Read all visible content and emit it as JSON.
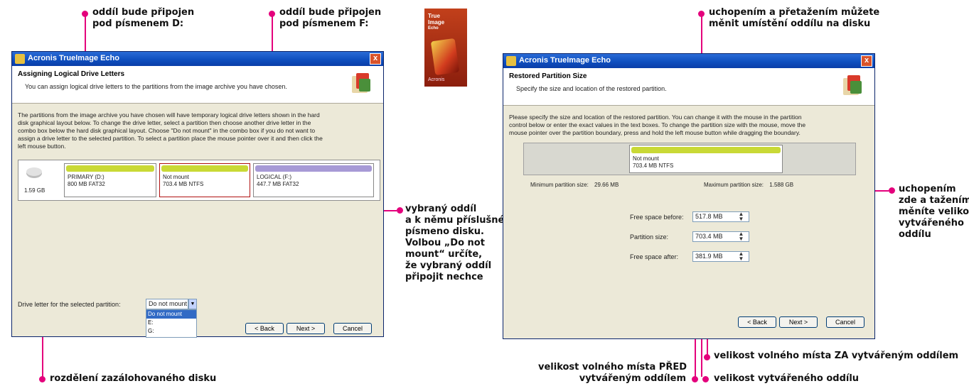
{
  "annotations": {
    "drive_d_l1": "oddíl bude připojen",
    "drive_d_l2": "pod písmenem D:",
    "drive_f_l1": "oddíl bude připojen",
    "drive_f_l2": "pod písmenem F:",
    "selected_l1": "vybraný oddíl",
    "selected_l2": "a k němu příslušné",
    "selected_l3": "písmeno disku.",
    "selected_l4": "Volbou „Do not",
    "selected_l5": "mount“ určíte,",
    "selected_l6": "že vybraný oddíl",
    "selected_l7": "připojit nechce",
    "layout": "rozdělení zazálohovaného disku",
    "drag_l1": "uchopením a přetažením můžete",
    "drag_l2": "měnit umístění oddílu na disku",
    "resize_l1": "uchopením",
    "resize_l2": "zde a tažením",
    "resize_l3": "měníte velikost",
    "resize_l4": "vytvářeného",
    "resize_l5": "oddílu",
    "after": "velikost volného místa ZA vytvářeným oddílem",
    "before_l1": "velikost volného místa PŘED",
    "before_l2": "vytvářeným oddílem",
    "partsize": "velikost vytvářeného oddílu"
  },
  "book": {
    "title_l1": "True",
    "title_l2": "Image",
    "title_l3": "Echo",
    "footer": "Acronis"
  },
  "window_left": {
    "title": "Acronis TrueImage Echo",
    "close": "x",
    "header_title": "Assigning Logical Drive Letters",
    "header_sub": "You can assign logical drive letters to the partitions from the image archive you have chosen.",
    "para1": "The partitions from the image archive you have chosen will have temporary logical drive letters shown in the hard",
    "para2": "disk graphical layout below. To change the drive letter, select a partition then choose another drive letter in the",
    "para3": "combo box below the hard disk graphical layout. Choose \"Do not mount\" in the combo box if you do not want to",
    "para4": "assign a drive letter to the selected partition. To select a partition place the mouse pointer over it and then click the",
    "para5": "left mouse button.",
    "disk_label": "1.59 GB",
    "partitions": [
      {
        "l1": "PRIMARY (D:)",
        "l2": "800 MB FAT32"
      },
      {
        "l1": "Not mount",
        "l2": "703.4 MB NTFS"
      },
      {
        "l1": "LOGICAL (F:)",
        "l2": "447.7 MB FAT32"
      }
    ],
    "drive_letter_label": "Drive letter for the selected partition:",
    "combo_value": "Do not mount",
    "dropdown": [
      "Do not mount",
      "E:",
      "G:"
    ],
    "btn_back": "< Back",
    "btn_next": "Next >",
    "btn_cancel": "Cancel"
  },
  "window_right": {
    "title": "Acronis TrueImage Echo",
    "close": "x",
    "header_title": "Restored Partition Size",
    "header_sub": "Specify the size and location of the restored partition.",
    "para1": "Please specify the size and location of the restored partition. You can change it with the mouse in the partition",
    "para2": "control below or enter the exact values in the text boxes. To change the partition size with the mouse, move the",
    "para3": "mouse pointer over the partition boundary, press and hold the left mouse button while dragging the boundary.",
    "partition_l1": "Not mount",
    "partition_l2": "703.4 MB NTFS",
    "min_label": "Minimum partition size:",
    "min_value": "29.66 MB",
    "max_label": "Maximum partition size:",
    "max_value": "1.588 GB",
    "free_before_label": "Free space before:",
    "free_before_value": "517.8 MB",
    "partition_size_label": "Partition size:",
    "partition_size_value": "703.4 MB",
    "free_after_label": "Free space after:",
    "free_after_value": "381.9 MB",
    "btn_back": "< Back",
    "btn_next": "Next >",
    "btn_cancel": "Cancel"
  }
}
